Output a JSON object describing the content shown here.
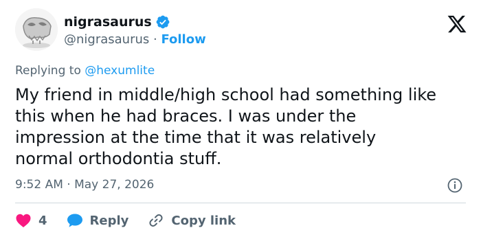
{
  "header": {
    "display_name": "nigrasaurus",
    "handle": "@nigrasaurus",
    "separator": " · ",
    "follow_label": "Follow",
    "verified_icon": "verified-badge-icon",
    "logo_icon": "x-logo-icon"
  },
  "reply_context": {
    "prefix": "Replying to ",
    "mention": "@hexumlite"
  },
  "tweet": {
    "text": "My friend in middle/high school had something like\nthis when he had braces. I was under the\nimpression at the time that it was relatively\nnormal orthodontia stuff.",
    "timestamp": "9:52 AM · May 27, 2026"
  },
  "actions": {
    "like_count": "4",
    "reply_label": "Reply",
    "copy_label": "Copy link"
  },
  "colors": {
    "accent": "#1d9bf0",
    "like": "#f91880",
    "text": "#0f1419",
    "muted": "#536471",
    "divider": "#cfd9de"
  }
}
